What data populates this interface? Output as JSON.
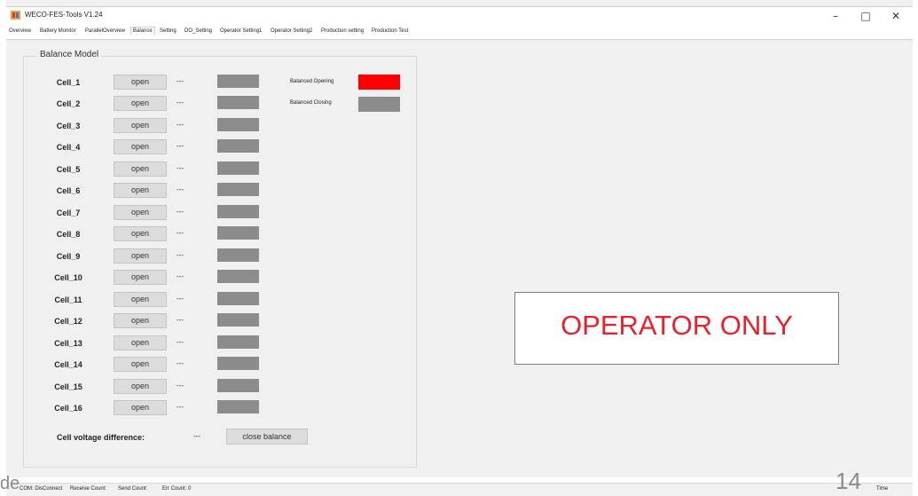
{
  "window": {
    "title": "WECO-FES-Tools V1.24",
    "controls": [
      "–",
      "□",
      "✕"
    ]
  },
  "tabs": [
    {
      "label": "Overview"
    },
    {
      "label": "Battery Monitor"
    },
    {
      "label": "ParallelOverview"
    },
    {
      "label": "Balance",
      "active": true
    },
    {
      "label": "Setting"
    },
    {
      "label": "DO_Setting"
    },
    {
      "label": "Operator Setting1"
    },
    {
      "label": "Operator Setting2"
    },
    {
      "label": "Production setting"
    },
    {
      "label": "Production Test"
    }
  ],
  "balance": {
    "group_title": "Balance Model",
    "cells": [
      {
        "label": "Cell_1",
        "button": "open",
        "value": "---"
      },
      {
        "label": "Cell_2",
        "button": "open",
        "value": "---"
      },
      {
        "label": "Cell_3",
        "button": "open",
        "value": "---"
      },
      {
        "label": "Cell_4",
        "button": "open",
        "value": "---"
      },
      {
        "label": "Cell_5",
        "button": "open",
        "value": "---"
      },
      {
        "label": "Cell_6",
        "button": "open",
        "value": "---"
      },
      {
        "label": "Cell_7",
        "button": "open",
        "value": "---"
      },
      {
        "label": "Cell_8",
        "button": "open",
        "value": "---"
      },
      {
        "label": "Cell_9",
        "button": "open",
        "value": "---"
      },
      {
        "label": "Cell_10",
        "button": "open",
        "value": "---"
      },
      {
        "label": "Cell_11",
        "button": "open",
        "value": "---"
      },
      {
        "label": "Cell_12",
        "button": "open",
        "value": "---"
      },
      {
        "label": "Cell_13",
        "button": "open",
        "value": "---"
      },
      {
        "label": "Cell_14",
        "button": "open",
        "value": "---"
      },
      {
        "label": "Cell_15",
        "button": "open",
        "value": "---"
      },
      {
        "label": "Cell_16",
        "button": "open",
        "value": "---"
      }
    ],
    "legend": [
      {
        "label": "Balanced Opening",
        "color": "#ff0000"
      },
      {
        "label": "Balanced Closing",
        "color": "#8c8c8c"
      }
    ],
    "diff_label": "Cell voltage difference:",
    "diff_value": "---",
    "close_button": "close balance"
  },
  "statusbar": {
    "com": "COM: DisConnect",
    "receive": "Receive Count:",
    "send": "Send Count:",
    "err": "Err Count: 0",
    "time": "Time"
  },
  "overlay": {
    "operator_note": "OPERATOR ONLY",
    "page_number": "14",
    "slide_fragment": "de"
  },
  "colors": {
    "status_box": "#8c8c8c",
    "operator_text": "#e8212a",
    "active_indicator": "#ff0000"
  }
}
